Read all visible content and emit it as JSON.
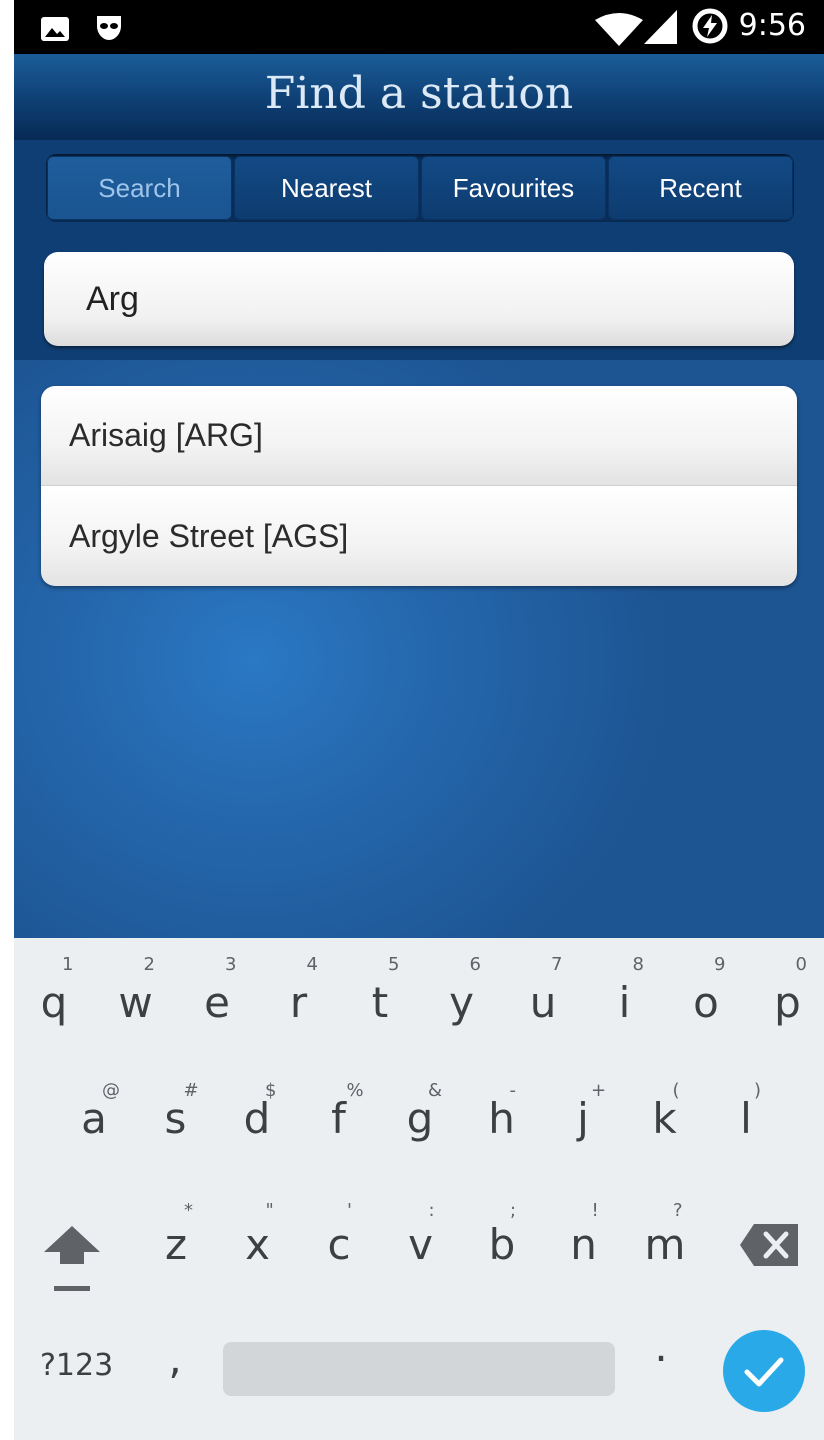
{
  "status_bar": {
    "time": "9:56",
    "left_icons": [
      "image-icon",
      "incognito-mask-icon"
    ],
    "right_icons": [
      "wifi-icon",
      "cell-signal-icon",
      "battery-charging-icon"
    ]
  },
  "header": {
    "title": "Find a station"
  },
  "tabs": [
    {
      "label": "Search",
      "active": true
    },
    {
      "label": "Nearest",
      "active": false
    },
    {
      "label": "Favourites",
      "active": false
    },
    {
      "label": "Recent",
      "active": false
    }
  ],
  "search": {
    "value": "Arg"
  },
  "results": [
    {
      "label": "Arisaig [ARG]"
    },
    {
      "label": "Argyle Street [AGS]"
    }
  ],
  "keyboard": {
    "row1": [
      {
        "key": "q",
        "alt": "1"
      },
      {
        "key": "w",
        "alt": "2"
      },
      {
        "key": "e",
        "alt": "3"
      },
      {
        "key": "r",
        "alt": "4"
      },
      {
        "key": "t",
        "alt": "5"
      },
      {
        "key": "y",
        "alt": "6"
      },
      {
        "key": "u",
        "alt": "7"
      },
      {
        "key": "i",
        "alt": "8"
      },
      {
        "key": "o",
        "alt": "9"
      },
      {
        "key": "p",
        "alt": "0"
      }
    ],
    "row2": [
      {
        "key": "a",
        "alt": "@"
      },
      {
        "key": "s",
        "alt": "#"
      },
      {
        "key": "d",
        "alt": "$"
      },
      {
        "key": "f",
        "alt": "%"
      },
      {
        "key": "g",
        "alt": "&"
      },
      {
        "key": "h",
        "alt": "-"
      },
      {
        "key": "j",
        "alt": "+"
      },
      {
        "key": "k",
        "alt": "("
      },
      {
        "key": "l",
        "alt": ")"
      }
    ],
    "row3": [
      {
        "key": "z",
        "alt": "*"
      },
      {
        "key": "x",
        "alt": "\""
      },
      {
        "key": "c",
        "alt": "'"
      },
      {
        "key": "v",
        "alt": ":"
      },
      {
        "key": "b",
        "alt": ";"
      },
      {
        "key": "n",
        "alt": "!"
      },
      {
        "key": "m",
        "alt": "?"
      }
    ],
    "symbols_label": "?123",
    "comma": ",",
    "period": ".",
    "accent_color": "#29a9e8"
  }
}
